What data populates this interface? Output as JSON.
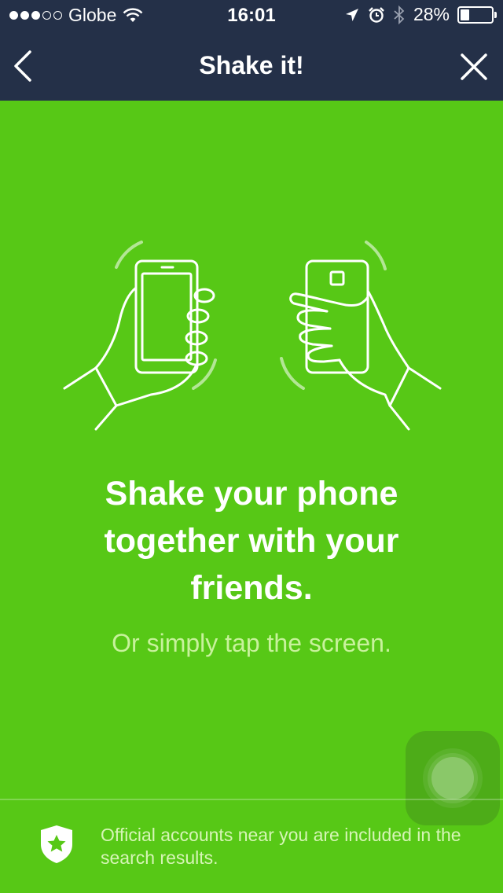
{
  "status_bar": {
    "carrier": "Globe",
    "time": "16:01",
    "battery_percent": "28%",
    "battery_level": 0.28,
    "signal_bars_filled": 3,
    "signal_bars_total": 5,
    "icons": [
      "wifi-icon",
      "location-arrow-icon",
      "alarm-icon",
      "bluetooth-icon",
      "battery-icon"
    ]
  },
  "nav": {
    "title": "Shake it!",
    "back_icon": "chevron-left-icon",
    "close_icon": "close-icon"
  },
  "main": {
    "headline": "Shake your phone\ntogether with your\nfriends.",
    "subline": "Or simply tap the screen.",
    "illustration": "hands-shaking-phones-illustration"
  },
  "footer": {
    "notice": "Official accounts near you are included in the search results.",
    "icon": "shield-star-icon"
  },
  "colors": {
    "background": "#57c816",
    "header": "#243048",
    "subline": "#c8f29c",
    "footer_text": "#d6f5b6"
  }
}
